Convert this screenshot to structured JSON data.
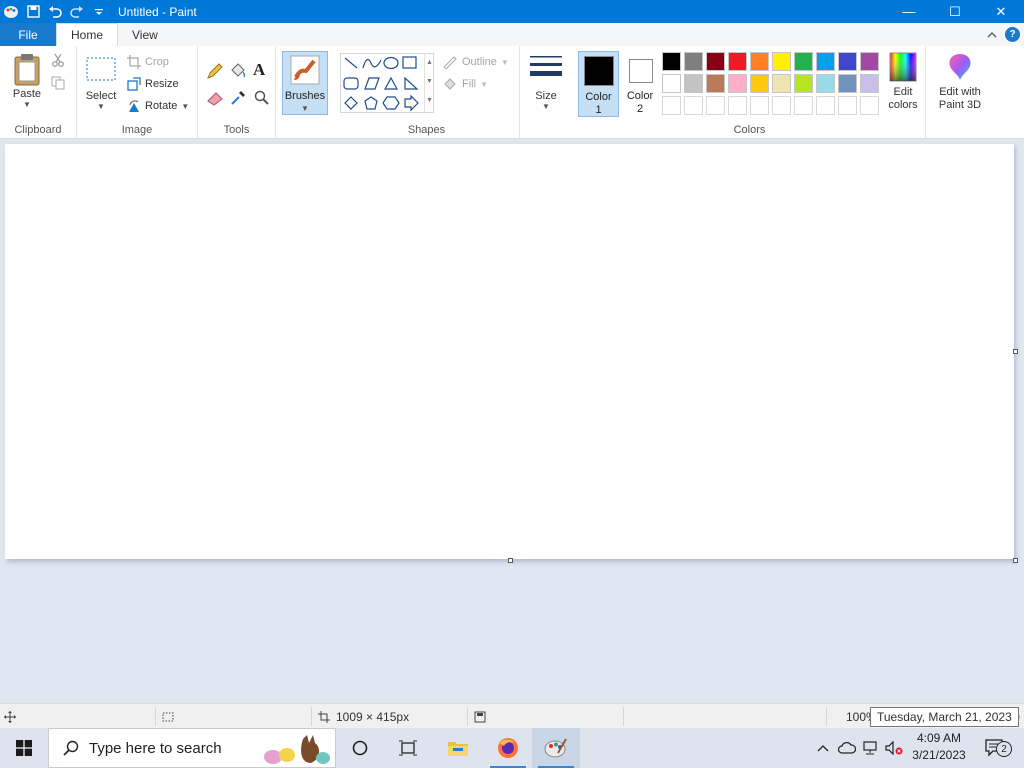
{
  "window": {
    "title": "Untitled - Paint",
    "controls": {
      "minimize": "—",
      "maximize": "☐",
      "close": "✕"
    }
  },
  "quick_access": {
    "save": "save-icon",
    "undo": "undo-icon",
    "redo": "redo-icon",
    "customize": "customize-icon"
  },
  "tabs": {
    "file": "File",
    "home": "Home",
    "view": "View"
  },
  "ribbon": {
    "clipboard": {
      "label": "Clipboard",
      "paste": "Paste"
    },
    "image": {
      "label": "Image",
      "select": "Select",
      "crop": "Crop",
      "resize": "Resize",
      "rotate": "Rotate"
    },
    "tools": {
      "label": "Tools"
    },
    "brushes": {
      "label": "Brushes"
    },
    "shapes": {
      "label": "Shapes",
      "outline": "Outline",
      "fill": "Fill"
    },
    "size": {
      "label": "Size"
    },
    "color1": {
      "label": "Color",
      "num": "1",
      "value": "#000000"
    },
    "color2": {
      "label": "Color",
      "num": "2",
      "value": "#ffffff"
    },
    "colors": {
      "label": "Colors",
      "row1": [
        "#000000",
        "#7f7f7f",
        "#880015",
        "#ed1c24",
        "#ff7f27",
        "#fff200",
        "#22b14c",
        "#00a2e8",
        "#3f48cc",
        "#a349a4"
      ],
      "row2": [
        "#ffffff",
        "#c3c3c3",
        "#b97a57",
        "#ffaec9",
        "#ffc90e",
        "#efe4b0",
        "#b5e61d",
        "#99d9ea",
        "#7092be",
        "#c8bfe7"
      ]
    },
    "edit_colors": {
      "line1": "Edit",
      "line2": "colors"
    },
    "paint3d": {
      "line1": "Edit with",
      "line2": "Paint 3D"
    }
  },
  "status": {
    "canvas_size": "1009 × 415px",
    "zoom": "100%",
    "tooltip": "Tuesday, March 21, 2023"
  },
  "taskbar": {
    "search_placeholder": "Type here to search",
    "time": "4:09 AM",
    "date": "3/21/2023",
    "notifications": "2"
  }
}
